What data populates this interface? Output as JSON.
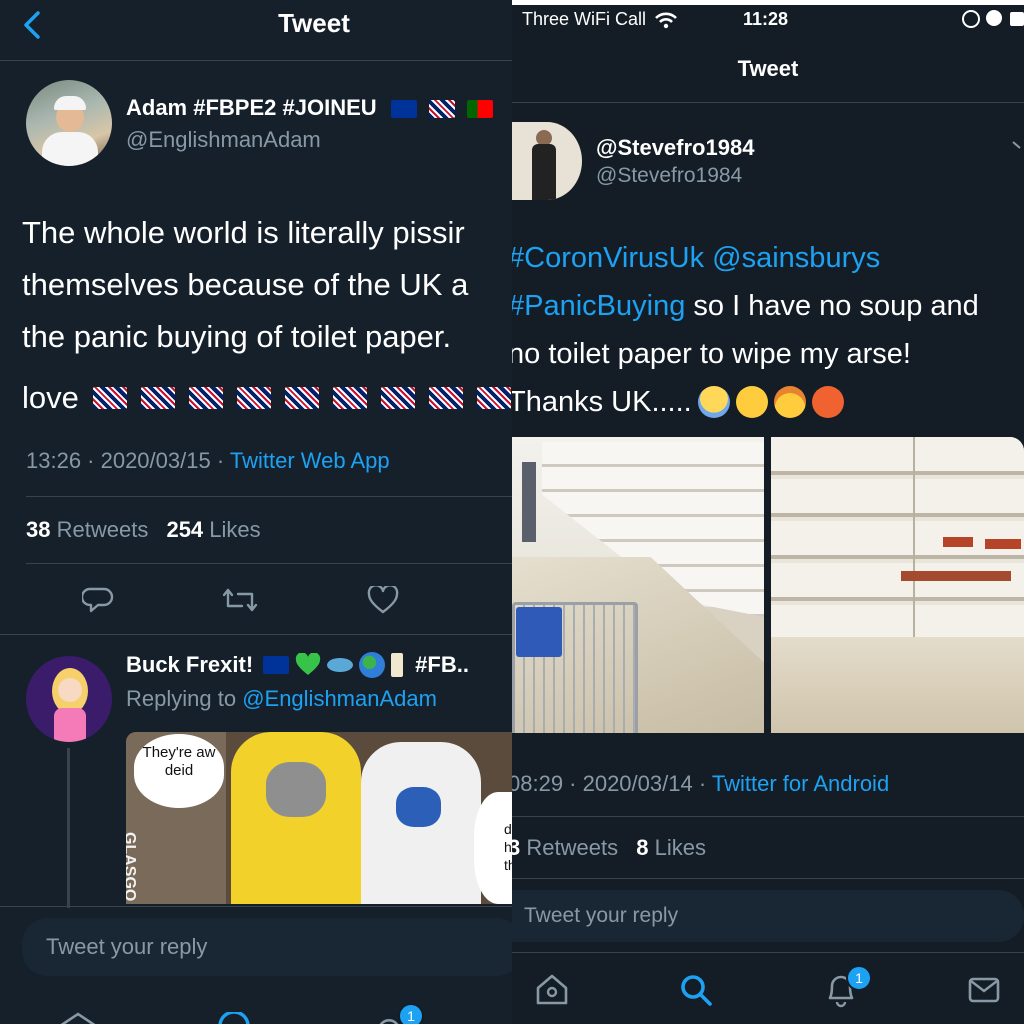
{
  "left": {
    "header_title": "Tweet",
    "author_name": "Adam #FBPE2 #JOINEU",
    "author_handle": "@EnglishmanAdam",
    "tweet_line1": "The whole world is literally pissir",
    "tweet_line2": "themselves because of the UK a",
    "tweet_line3": "the panic buying of toilet paper.",
    "tweet_love": "love",
    "timestamp": "13:26 · 2020/03/15 · ",
    "source": "Twitter Web App",
    "retweets_count": "38",
    "retweets_label": "Retweets",
    "likes_count": "254",
    "likes_label": "Likes",
    "reply_name": "Buck Frexit!",
    "reply_tag": "#FB..",
    "replying_to_label": "Replying to ",
    "replying_to_handle": "@EnglishmanAdam",
    "meme_caption": "They're aw deid",
    "meme_side_text": "GLASGO",
    "meme_right_text": "d\nh\nth",
    "reply_placeholder": "Tweet your reply",
    "notification_count": "1"
  },
  "right": {
    "carrier": "Three WiFi Call",
    "time": "11:28",
    "header_title": "Tweet",
    "author_name": "@Stevefro1984",
    "author_handle": "@Stevefro1984",
    "hashtag1": "#CoronVirusUk",
    "mention1": "@sainsburys",
    "hashtag2": "#PanicBuying",
    "text1": " so I have no soup and",
    "text2": "no toilet paper to wipe my arse!",
    "text3": "Thanks UK.....",
    "timestamp": "08:29 · 2020/03/14 · ",
    "source": "Twitter for Android",
    "retweets_count": "3",
    "retweets_label": "Retweets",
    "likes_count": "8",
    "likes_label": "Likes",
    "reply_placeholder": "Tweet your reply",
    "notification_count": "1"
  },
  "colors": {
    "accent": "#1da1f2",
    "bg": "#15202b",
    "muted": "#8899a6"
  }
}
